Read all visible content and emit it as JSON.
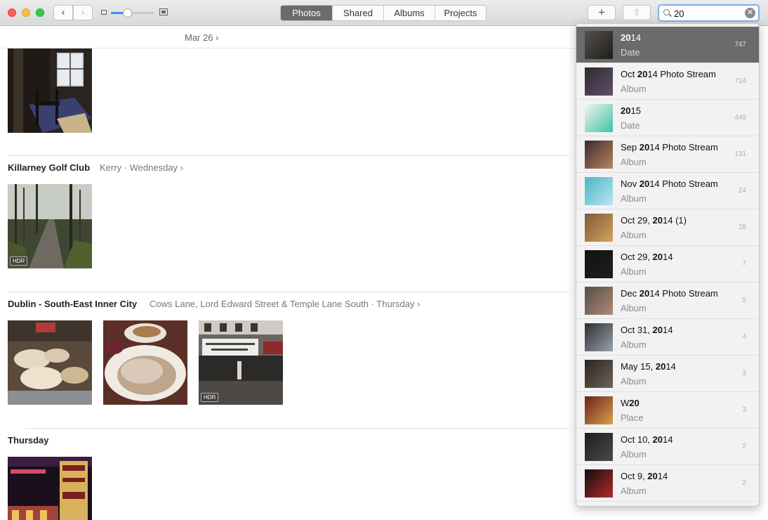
{
  "toolbar": {
    "back": "‹",
    "forward": "›",
    "zoom": 0.37,
    "tabs": [
      "Photos",
      "Shared",
      "Albums",
      "Projects"
    ],
    "active_tab": "Photos",
    "add": "+",
    "share": "⇧"
  },
  "search": {
    "value": "20",
    "clear": "✕"
  },
  "main": {
    "top_date": "Mar 26 ›",
    "sections": [
      {
        "title": "Killarney Golf Club",
        "sub": "Kerry  ·  Wednesday ›"
      },
      {
        "title": "Dublin - South-East Inner City",
        "sub": "Cows Lane, Lord Edward Street & Temple Lane South  ·  Thursday ›"
      },
      {
        "title": "Thursday",
        "sub": ""
      }
    ],
    "badges": [
      "HDR",
      "HDR"
    ]
  },
  "results": [
    {
      "pre": "",
      "bold": "20",
      "post": "14",
      "kind": "Date",
      "count": "747",
      "selected": true
    },
    {
      "pre": "Oct ",
      "bold": "20",
      "post": "14 Photo Stream",
      "kind": "Album",
      "count": "714"
    },
    {
      "pre": "",
      "bold": "20",
      "post": "15",
      "kind": "Date",
      "count": "449"
    },
    {
      "pre": "Sep ",
      "bold": "20",
      "post": "14 Photo Stream",
      "kind": "Album",
      "count": "131"
    },
    {
      "pre": "Nov ",
      "bold": "20",
      "post": "14 Photo Stream",
      "kind": "Album",
      "count": "24"
    },
    {
      "pre": "Oct 29, ",
      "bold": "20",
      "post": "14 (1)",
      "kind": "Album",
      "count": "18"
    },
    {
      "pre": "Oct 29, ",
      "bold": "20",
      "post": "14",
      "kind": "Album",
      "count": "7"
    },
    {
      "pre": "Dec ",
      "bold": "20",
      "post": "14 Photo Stream",
      "kind": "Album",
      "count": "5"
    },
    {
      "pre": "Oct 31, ",
      "bold": "20",
      "post": "14",
      "kind": "Album",
      "count": "4"
    },
    {
      "pre": "May 15, ",
      "bold": "20",
      "post": "14",
      "kind": "Album",
      "count": "3"
    },
    {
      "pre": "W",
      "bold": "20",
      "post": "",
      "kind": "Place",
      "count": "3"
    },
    {
      "pre": "Oct 10, ",
      "bold": "20",
      "post": "14",
      "kind": "Album",
      "count": "2"
    },
    {
      "pre": "Oct 9, ",
      "bold": "20",
      "post": "14",
      "kind": "Album",
      "count": "2"
    }
  ]
}
